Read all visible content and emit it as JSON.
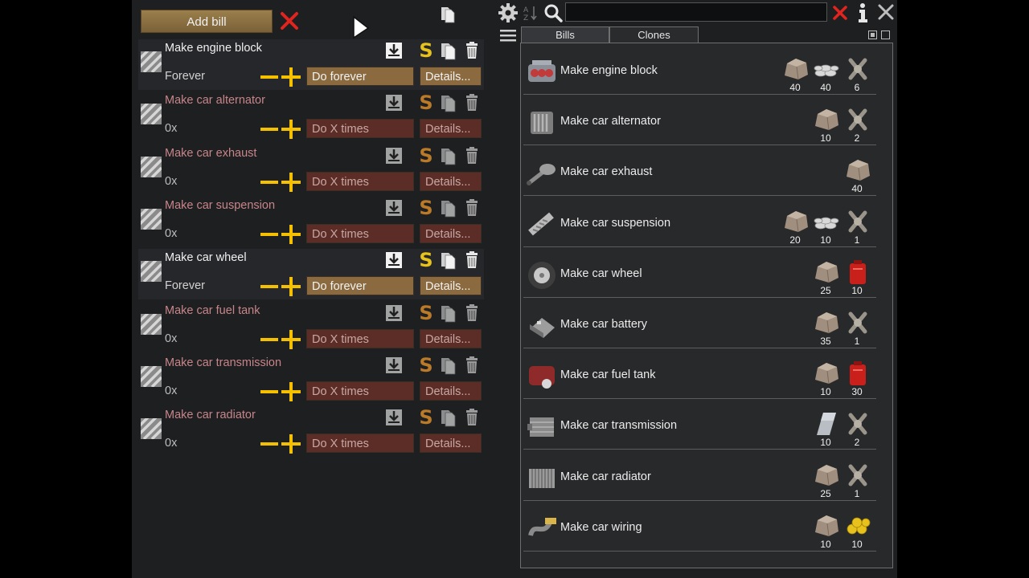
{
  "toolbar": {
    "add_bill_label": "Add bill",
    "search": {
      "value": "",
      "placeholder": ""
    }
  },
  "tabs": [
    {
      "label": "Bills",
      "active": true
    },
    {
      "label": "Clones",
      "active": false
    }
  ],
  "bills": [
    {
      "name": "Make engine block",
      "count": "Forever",
      "mode": "Do forever",
      "details": "Details...",
      "active": true
    },
    {
      "name": "Make car alternator",
      "count": "0x",
      "mode": "Do X times",
      "details": "Details...",
      "active": false
    },
    {
      "name": "Make car exhaust",
      "count": "0x",
      "mode": "Do X times",
      "details": "Details...",
      "active": false
    },
    {
      "name": "Make car suspension",
      "count": "0x",
      "mode": "Do X times",
      "details": "Details...",
      "active": false
    },
    {
      "name": "Make car wheel",
      "count": "Forever",
      "mode": "Do forever",
      "details": "Details...",
      "active": true
    },
    {
      "name": "Make car fuel tank",
      "count": "0x",
      "mode": "Do X times",
      "details": "Details...",
      "active": false
    },
    {
      "name": "Make car transmission",
      "count": "0x",
      "mode": "Do X times",
      "details": "Details...",
      "active": false
    },
    {
      "name": "Make car radiator",
      "count": "0x",
      "mode": "Do X times",
      "details": "Details...",
      "active": false
    }
  ],
  "bill_icons": {
    "save": "download-icon",
    "store": "S",
    "copy": "copy-icon",
    "delete": "trash-icon"
  },
  "recipes": [
    {
      "name": "Make engine block",
      "icon": "engine-block-icon",
      "ingredients": [
        {
          "icon": "steel-chunk-icon",
          "amount": "40"
        },
        {
          "icon": "components-pile-icon",
          "amount": "40"
        },
        {
          "icon": "component-icon",
          "amount": "6"
        }
      ]
    },
    {
      "name": "Make car alternator",
      "icon": "alternator-icon",
      "ingredients": [
        {
          "icon": "steel-chunk-icon",
          "amount": "10"
        },
        {
          "icon": "component-icon",
          "amount": "2"
        }
      ]
    },
    {
      "name": "Make car exhaust",
      "icon": "exhaust-icon",
      "ingredients": [
        {
          "icon": "steel-chunk-icon",
          "amount": "40"
        }
      ]
    },
    {
      "name": "Make car suspension",
      "icon": "suspension-icon",
      "ingredients": [
        {
          "icon": "steel-chunk-icon",
          "amount": "20"
        },
        {
          "icon": "components-pile-icon",
          "amount": "10"
        },
        {
          "icon": "component-icon",
          "amount": "1"
        }
      ]
    },
    {
      "name": "Make car wheel",
      "icon": "wheel-icon",
      "ingredients": [
        {
          "icon": "steel-chunk-icon",
          "amount": "25"
        },
        {
          "icon": "fuel-can-icon",
          "amount": "10"
        }
      ]
    },
    {
      "name": "Make car battery",
      "icon": "battery-icon",
      "ingredients": [
        {
          "icon": "steel-chunk-icon",
          "amount": "35"
        },
        {
          "icon": "component-icon",
          "amount": "1"
        }
      ]
    },
    {
      "name": "Make car fuel tank",
      "icon": "fuel-tank-icon",
      "ingredients": [
        {
          "icon": "steel-chunk-icon",
          "amount": "10"
        },
        {
          "icon": "fuel-can-icon",
          "amount": "30"
        }
      ]
    },
    {
      "name": "Make car transmission",
      "icon": "transmission-icon",
      "ingredients": [
        {
          "icon": "plasteel-icon",
          "amount": "10"
        },
        {
          "icon": "component-icon",
          "amount": "2"
        }
      ]
    },
    {
      "name": "Make car radiator",
      "icon": "radiator-icon",
      "ingredients": [
        {
          "icon": "steel-chunk-icon",
          "amount": "25"
        },
        {
          "icon": "component-icon",
          "amount": "1"
        }
      ]
    },
    {
      "name": "Make car wiring",
      "icon": "wiring-icon",
      "ingredients": [
        {
          "icon": "steel-chunk-icon",
          "amount": "10"
        },
        {
          "icon": "gold-icon",
          "amount": "10"
        }
      ]
    }
  ],
  "colors": {
    "accent": "#e8c21c",
    "active_button": "#8a6a3e",
    "inactive_button": "#5c2d27",
    "clear_red": "#e0241f",
    "inactive_text": "#c7858a"
  }
}
